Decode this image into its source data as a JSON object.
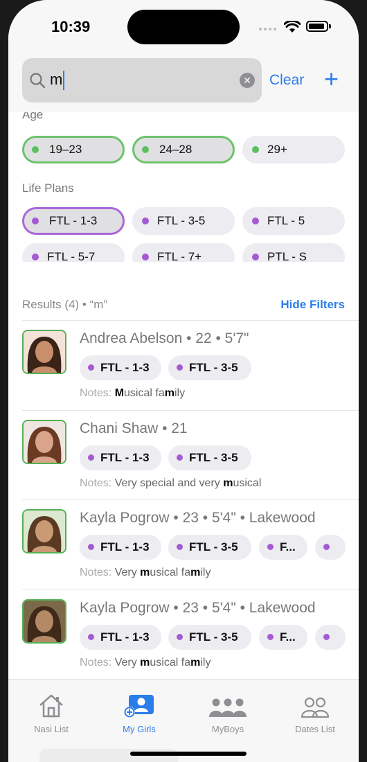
{
  "status_bar": {
    "time": "10:39"
  },
  "search": {
    "value": "m",
    "clear_label": "Clear",
    "add_label": "+"
  },
  "filters": {
    "age_label": "Age",
    "age_chips": [
      {
        "label": "19–23",
        "selected": true
      },
      {
        "label": "24–28",
        "selected": true
      },
      {
        "label": "29+",
        "selected": false
      }
    ],
    "life_plans_label": "Life Plans",
    "life_plan_chips": [
      {
        "label": "FTL - 1-3",
        "selected": true
      },
      {
        "label": "FTL - 3-5",
        "selected": false
      },
      {
        "label": "FTL - 5",
        "selected": false
      },
      {
        "label": "FTL - 5-7",
        "selected": false
      },
      {
        "label": "FTL - 7+",
        "selected": false
      },
      {
        "label": "PTL - S",
        "selected": false
      }
    ]
  },
  "results": {
    "header": "Results (4) • “m”",
    "hide_filters_label": "Hide Filters",
    "notes_label": "Notes:",
    "items": [
      {
        "name_line": "Andrea Abelson • 22 • 5'7\"",
        "tags": [
          "FTL - 1-3",
          "FTL - 3-5"
        ],
        "notes_parts": [
          [
            "M",
            true
          ],
          [
            "usical fa",
            false
          ],
          [
            "m",
            true
          ],
          [
            "ily",
            false
          ]
        ]
      },
      {
        "name_line": "Chani Shaw • 21",
        "tags": [
          "FTL - 1-3",
          "FTL - 3-5"
        ],
        "notes_parts": [
          [
            "Very special  and very ",
            false
          ],
          [
            "m",
            true
          ],
          [
            "usical",
            false
          ]
        ]
      },
      {
        "name_line": "Kayla Pogrow • 23 • 5'4\" • Lakewood",
        "tags": [
          "FTL - 1-3",
          "FTL - 3-5",
          "F...",
          ""
        ],
        "notes_parts": [
          [
            "Very ",
            false
          ],
          [
            "m",
            true
          ],
          [
            "usical fa",
            false
          ],
          [
            "m",
            true
          ],
          [
            "ily",
            false
          ]
        ]
      },
      {
        "name_line": "Kayla Pogrow • 23 • 5'4\" • Lakewood",
        "tags": [
          "FTL - 1-3",
          "FTL - 3-5",
          "F...",
          ""
        ],
        "notes_parts": [
          [
            "Very ",
            false
          ],
          [
            "m",
            true
          ],
          [
            "usical fa",
            false
          ],
          [
            "m",
            true
          ],
          [
            "ily",
            false
          ]
        ]
      }
    ]
  },
  "tabs": [
    {
      "label": "Nasi List",
      "icon": "house-icon",
      "active": false
    },
    {
      "label": "My Girls",
      "icon": "person-add-icon",
      "active": true
    },
    {
      "label": "MyBoys",
      "icon": "people-three-icon",
      "active": false
    },
    {
      "label": "Dates List",
      "icon": "people-two-icon",
      "active": false
    }
  ],
  "colors": {
    "accent": "#2b7de9",
    "age_dot": "#5cc05c",
    "plan_dot": "#a45ad4"
  }
}
